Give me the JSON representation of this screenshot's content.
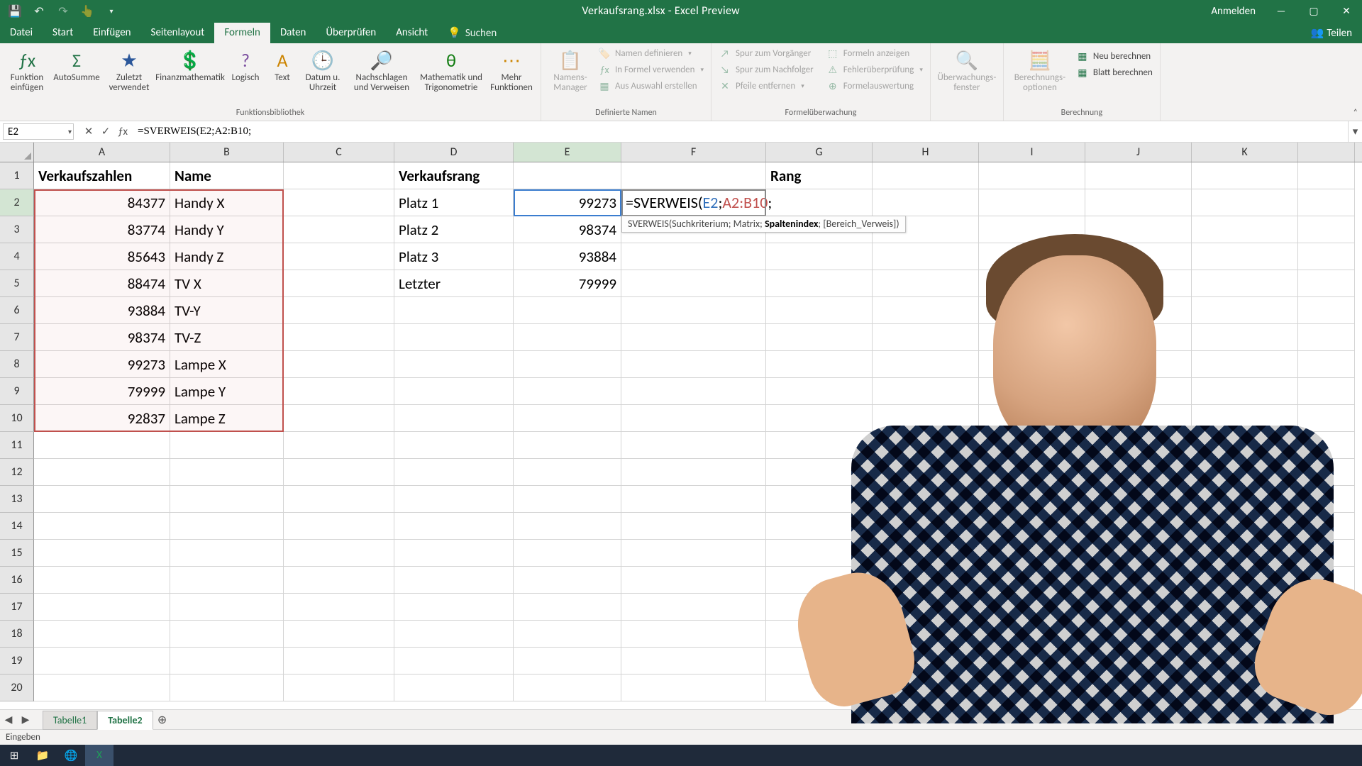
{
  "titlebar": {
    "title": "Verkaufsrang.xlsx  -  Excel Preview",
    "signin": "Anmelden"
  },
  "tabs": {
    "datei": "Datei",
    "start": "Start",
    "einfugen": "Einfügen",
    "seitenlayout": "Seitenlayout",
    "formeln": "Formeln",
    "daten": "Daten",
    "uberprufen": "Überprüfen",
    "ansicht": "Ansicht",
    "search": "Suchen",
    "teilen": "Teilen"
  },
  "ribbon": {
    "funktion": "Funktion einfügen",
    "autosumme": "AutoSumme",
    "zuletzt": "Zuletzt verwendet",
    "finanz": "Finanzmathematik",
    "logisch": "Logisch",
    "text": "Text",
    "datum": "Datum u. Uhrzeit",
    "nachschlagen": "Nachschlagen und Verweisen",
    "mathtrig": "Mathematik und Trigonometrie",
    "mehr": "Mehr Funktionen",
    "grp_bib": "Funktionsbibliothek",
    "namensmgr": "Namens-Manager",
    "namendef": "Namen definieren",
    "informel": "In Formel verwenden",
    "ausauswahl": "Aus Auswahl erstellen",
    "grp_names": "Definierte Namen",
    "spurvor": "Spur zum Vorgänger",
    "spurnach": "Spur zum Nachfolger",
    "pfeileent": "Pfeile entfernen",
    "formelnanz": "Formeln anzeigen",
    "fehlerpr": "Fehlerüberprüfung",
    "formelaus": "Formelauswertung",
    "grp_watch": "Formelüberwachung",
    "uberwfenster": "Überwachungs-fenster",
    "berechopt": "Berechnungs-optionen",
    "neuber": "Neu berechnen",
    "blattber": "Blatt berechnen",
    "grp_calc": "Berechnung"
  },
  "namebox": "E2",
  "formula": "=SVERWEIS(E2;A2:B10;",
  "inc": {
    "prefix": "=SVERWEIS(",
    "arg1": "E2",
    "sep1": ";",
    "arg2": "A2:B10",
    "sep2": ";"
  },
  "tooltip": {
    "text1": "SVERWEIS(Suchkriterium; Matrix; ",
    "bold": "Spaltenindex",
    "text2": "; [Bereich_Verweis])"
  },
  "columns": [
    "A",
    "B",
    "C",
    "D",
    "E",
    "F",
    "G",
    "H",
    "I",
    "J",
    "K"
  ],
  "rowcount": 20,
  "cells": {
    "A1": "Verkaufszahlen",
    "B1": "Name",
    "D1": "Verkaufsrang",
    "G1": "Rang",
    "A2": "84377",
    "B2": "Handy X",
    "D2": "Platz 1",
    "E2": "99273",
    "A3": "83774",
    "B3": "Handy Y",
    "D3": "Platz 2",
    "E3": "98374",
    "A4": "85643",
    "B4": "Handy Z",
    "D4": "Platz 3",
    "E4": "93884",
    "A5": "88474",
    "B5": "TV X",
    "D5": "Letzter",
    "E5": "79999",
    "A6": "93884",
    "B6": "TV-Y",
    "A7": "98374",
    "B7": "TV-Z",
    "A8": "99273",
    "B8": "Lampe X",
    "A9": "79999",
    "B9": "Lampe Y",
    "A10": "92837",
    "B10": "Lampe Z"
  },
  "sheettabs": {
    "t1": "Tabelle1",
    "t2": "Tabelle2"
  },
  "status": "Eingeben"
}
